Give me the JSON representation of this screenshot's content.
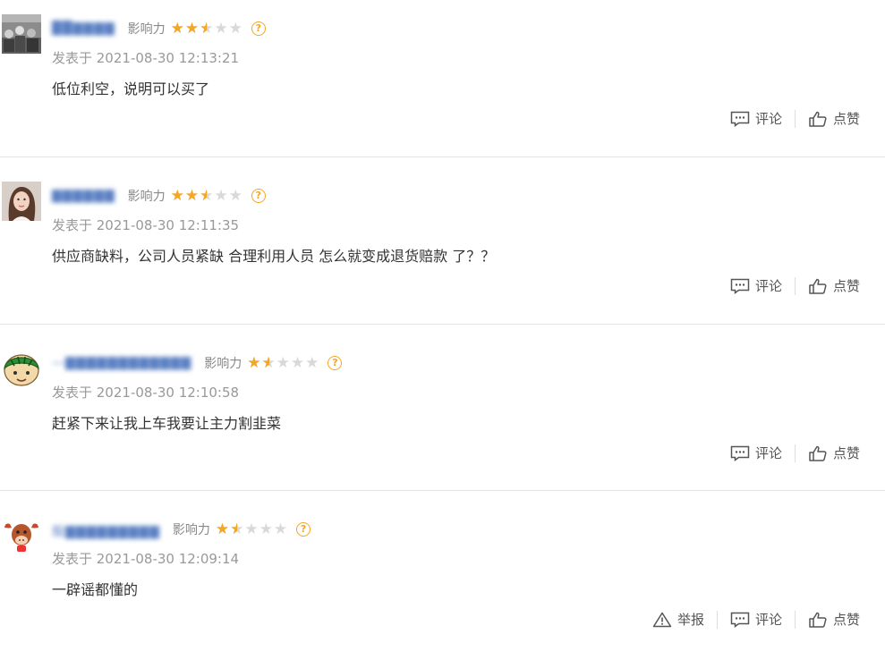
{
  "labels": {
    "influence": "影响力",
    "comment": "评论",
    "like": "点赞",
    "report": "举报"
  },
  "colors": {
    "star_filled": "#f5a623",
    "star_empty": "#d9d9d9",
    "username_blurred": "#5a7fc2"
  },
  "comments": [
    {
      "username": "██▇▇▇▇",
      "influence_stars": 2.5,
      "time": "发表于 2021-08-30 12:13:21",
      "text": "低位利空，说明可以买了",
      "avatar_icon": "crowd-photo-avatar"
    },
    {
      "username": "▇▇▇▇▇▇",
      "influence_stars": 2.5,
      "time": "发表于 2021-08-30 12:11:35",
      "text": "供应商缺料，公司人员紧缺 合理利用人员 怎么就变成退货赔款 了？？",
      "avatar_icon": "woman-photo-avatar"
    },
    {
      "username": "—▇▇▇▇▇▇▇▇▇▇▇▇",
      "influence_stars": 1.5,
      "time": "发表于 2021-08-30 12:10:58",
      "text": "赶紧下来让我上车我要让主力割韭菜",
      "avatar_icon": "watermelon-cartoon-avatar"
    },
    {
      "username": "股▇▇▇▇▇▇▇▇▇",
      "influence_stars": 1.5,
      "time": "发表于 2021-08-30 12:09:14",
      "text": "一辟谣都懂的",
      "avatar_icon": "cow-cartoon-avatar"
    }
  ]
}
